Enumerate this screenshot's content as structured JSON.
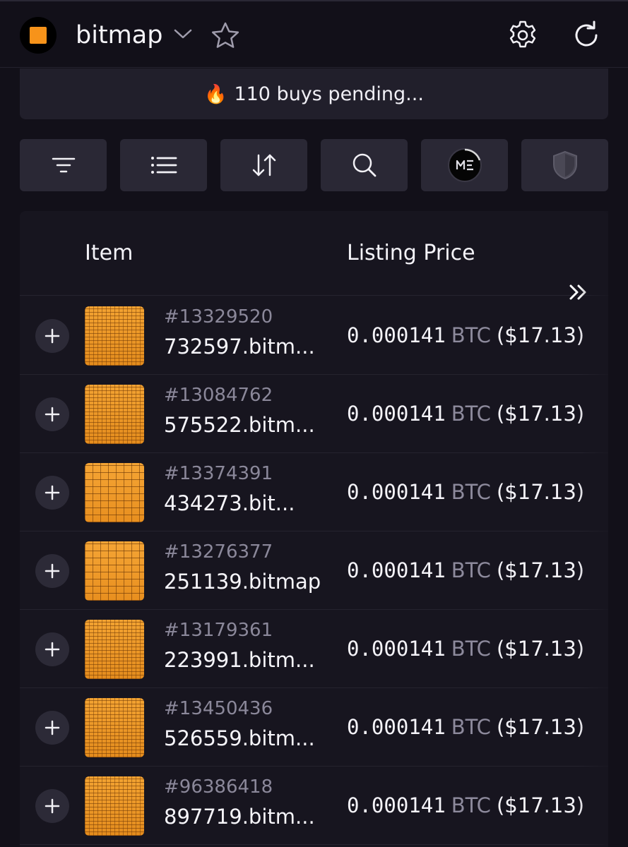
{
  "header": {
    "title": "bitmap",
    "logo_color": "#f7931a",
    "icons": [
      "chevron-down-icon",
      "star-icon",
      "gear-icon",
      "refresh-icon"
    ]
  },
  "banner": {
    "icon": "fire-icon",
    "text": "110 buys pending..."
  },
  "toolbar": {
    "buttons": [
      "filter-icon",
      "list-icon",
      "sort-icon",
      "search-icon",
      "magic-eden-icon",
      "shield-icon"
    ]
  },
  "table": {
    "columns": [
      "Item",
      "Listing Price"
    ],
    "rows": [
      {
        "inscription": "#13329520",
        "name": "732597.bitm...",
        "price": "0.000141",
        "currency": "BTC",
        "usd": "($17.13)"
      },
      {
        "inscription": "#13084762",
        "name": "575522.bitm...",
        "price": "0.000141",
        "currency": "BTC",
        "usd": "($17.13)"
      },
      {
        "inscription": "#13374391",
        "name": "434273.bit...",
        "price": "0.000141",
        "currency": "BTC",
        "usd": "($17.13)"
      },
      {
        "inscription": "#13276377",
        "name": "251139.bitmap",
        "price": "0.000141",
        "currency": "BTC",
        "usd": "($17.13)"
      },
      {
        "inscription": "#13179361",
        "name": "223991.bitm...",
        "price": "0.000141",
        "currency": "BTC",
        "usd": "($17.13)"
      },
      {
        "inscription": "#13450436",
        "name": "526559.bitm...",
        "price": "0.000141",
        "currency": "BTC",
        "usd": "($17.13)"
      },
      {
        "inscription": "#96386418",
        "name": "897719.bitm...",
        "price": "0.000141",
        "currency": "BTC",
        "usd": "($17.13)"
      }
    ]
  },
  "colors": {
    "background": "#121019",
    "panel": "#2a2835",
    "accent": "#f7931a",
    "muted_text": "#8b889a"
  }
}
